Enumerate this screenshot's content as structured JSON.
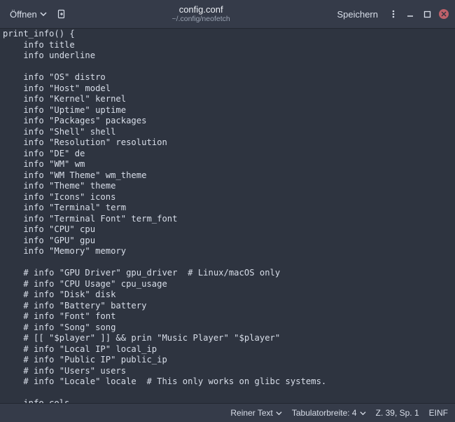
{
  "header": {
    "open": "Öffnen",
    "save": "Speichern",
    "title": "config.conf",
    "path": "~/.config/neofetch"
  },
  "editor": {
    "content": "print_info() {\n    info title\n    info underline\n\n    info \"OS\" distro\n    info \"Host\" model\n    info \"Kernel\" kernel\n    info \"Uptime\" uptime\n    info \"Packages\" packages\n    info \"Shell\" shell\n    info \"Resolution\" resolution\n    info \"DE\" de\n    info \"WM\" wm\n    info \"WM Theme\" wm_theme\n    info \"Theme\" theme\n    info \"Icons\" icons\n    info \"Terminal\" term\n    info \"Terminal Font\" term_font\n    info \"CPU\" cpu\n    info \"GPU\" gpu\n    info \"Memory\" memory\n\n    # info \"GPU Driver\" gpu_driver  # Linux/macOS only\n    # info \"CPU Usage\" cpu_usage\n    # info \"Disk\" disk\n    # info \"Battery\" battery\n    # info \"Font\" font\n    # info \"Song\" song\n    # [[ \"$player\" ]] && prin \"Music Player\" \"$player\"\n    # info \"Local IP\" local_ip\n    # info \"Public IP\" public_ip\n    # info \"Users\" users\n    # info \"Locale\" locale  # This only works on glibc systems.\n\n    info cols\n}"
  },
  "status": {
    "syntax": "Reiner Text",
    "tabwidth": "Tabulatorbreite: 4",
    "position": "Z. 39, Sp. 1",
    "insert": "EINF"
  }
}
